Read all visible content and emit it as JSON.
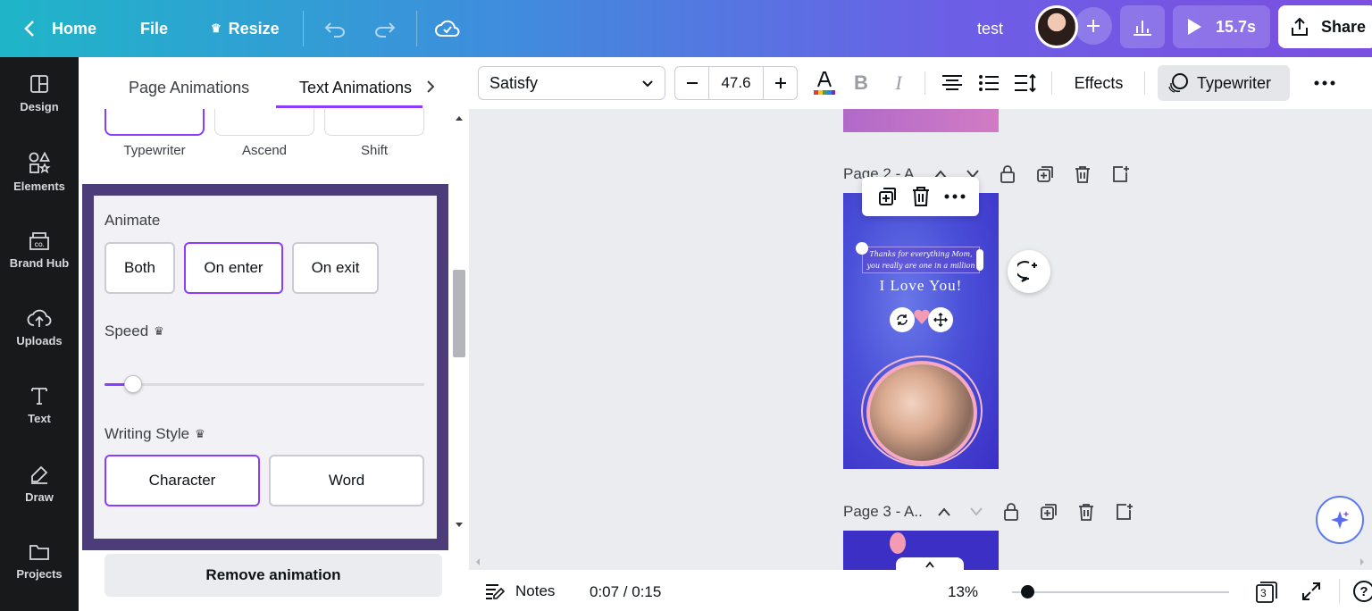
{
  "topbar": {
    "home_label": "Home",
    "file_label": "File",
    "resize_label": "Resize",
    "doc_title": "test",
    "play_duration": "15.7s",
    "share_label": "Share"
  },
  "rail": {
    "items": [
      {
        "label": "Design"
      },
      {
        "label": "Elements"
      },
      {
        "label": "Brand Hub"
      },
      {
        "label": "Uploads"
      },
      {
        "label": "Text"
      },
      {
        "label": "Draw"
      },
      {
        "label": "Projects"
      }
    ]
  },
  "panel": {
    "tabs": [
      "Page Animations",
      "Text Animations"
    ],
    "animations": [
      "Typewriter",
      "Ascend",
      "Shift"
    ],
    "animate_label": "Animate",
    "animate_options": [
      "Both",
      "On enter",
      "On exit"
    ],
    "animate_selected": "On enter",
    "speed_label": "Speed",
    "speed_value": 0.09,
    "writing_style_label": "Writing Style",
    "writing_options": [
      "Character",
      "Word"
    ],
    "writing_selected": "Character",
    "remove_label": "Remove animation"
  },
  "toolbar": {
    "font": "Satisfy",
    "font_size": "47.6",
    "effects_label": "Effects",
    "animation_label": "Typewriter"
  },
  "canvas": {
    "page2_label": "Page 2 - A..",
    "page3_label": "Page 3 - A..",
    "art_script_line1": "Thanks for everything Mom,",
    "art_script_line2": "you really are one in a million",
    "art_headline": "I Love You!"
  },
  "bottombar": {
    "notes_label": "Notes",
    "time": "0:07 / 0:15",
    "zoom": "13%",
    "page_count": "3",
    "help": "?"
  },
  "colors": {
    "accent": "#8b3dff",
    "panel_highlight": "#4c3d7a",
    "rail_bg": "#18191b"
  }
}
